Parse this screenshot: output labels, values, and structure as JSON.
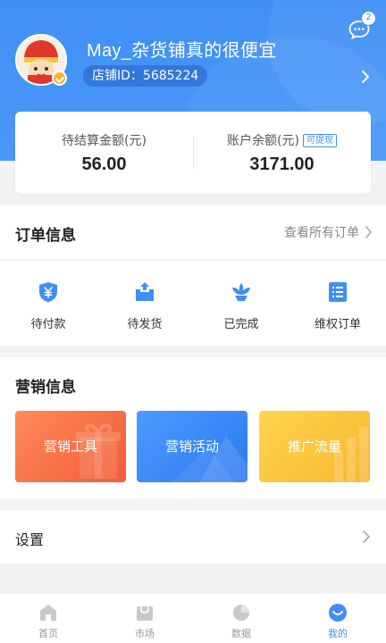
{
  "header": {
    "shop_name": "May_杂货铺真的很便宜",
    "shop_id": "店铺ID：5685224",
    "message_count": "2"
  },
  "balance": {
    "pending_label": "待结算金额(元)",
    "pending_value": "56.00",
    "account_label": "账户余额(元)",
    "withdraw_tag": "可提现",
    "account_value": "3171.00"
  },
  "orders": {
    "title": "订单信息",
    "view_all": "查看所有订单",
    "items": [
      {
        "label": "待付款",
        "icon": "yuan-shield-icon"
      },
      {
        "label": "待发货",
        "icon": "box-upload-icon"
      },
      {
        "label": "已完成",
        "icon": "lotus-icon"
      },
      {
        "label": "维权订单",
        "icon": "document-list-icon"
      }
    ]
  },
  "marketing": {
    "title": "营销信息",
    "cards": [
      {
        "label": "营销工具",
        "color": "#f25c36"
      },
      {
        "label": "营销活动",
        "color": "#2e79f0"
      },
      {
        "label": "推广流量",
        "color": "#f7b733"
      }
    ]
  },
  "settings": {
    "label": "设置"
  },
  "tabbar": {
    "items": [
      {
        "label": "首页",
        "icon": "home-icon"
      },
      {
        "label": "市场",
        "icon": "shopping-bag-icon"
      },
      {
        "label": "数据",
        "icon": "pie-chart-icon"
      },
      {
        "label": "我的",
        "icon": "profile-smile-icon"
      }
    ],
    "active_color": "#3f8ff6"
  },
  "colors": {
    "primary": "#3f8ff6",
    "background": "#f2f3f5"
  }
}
